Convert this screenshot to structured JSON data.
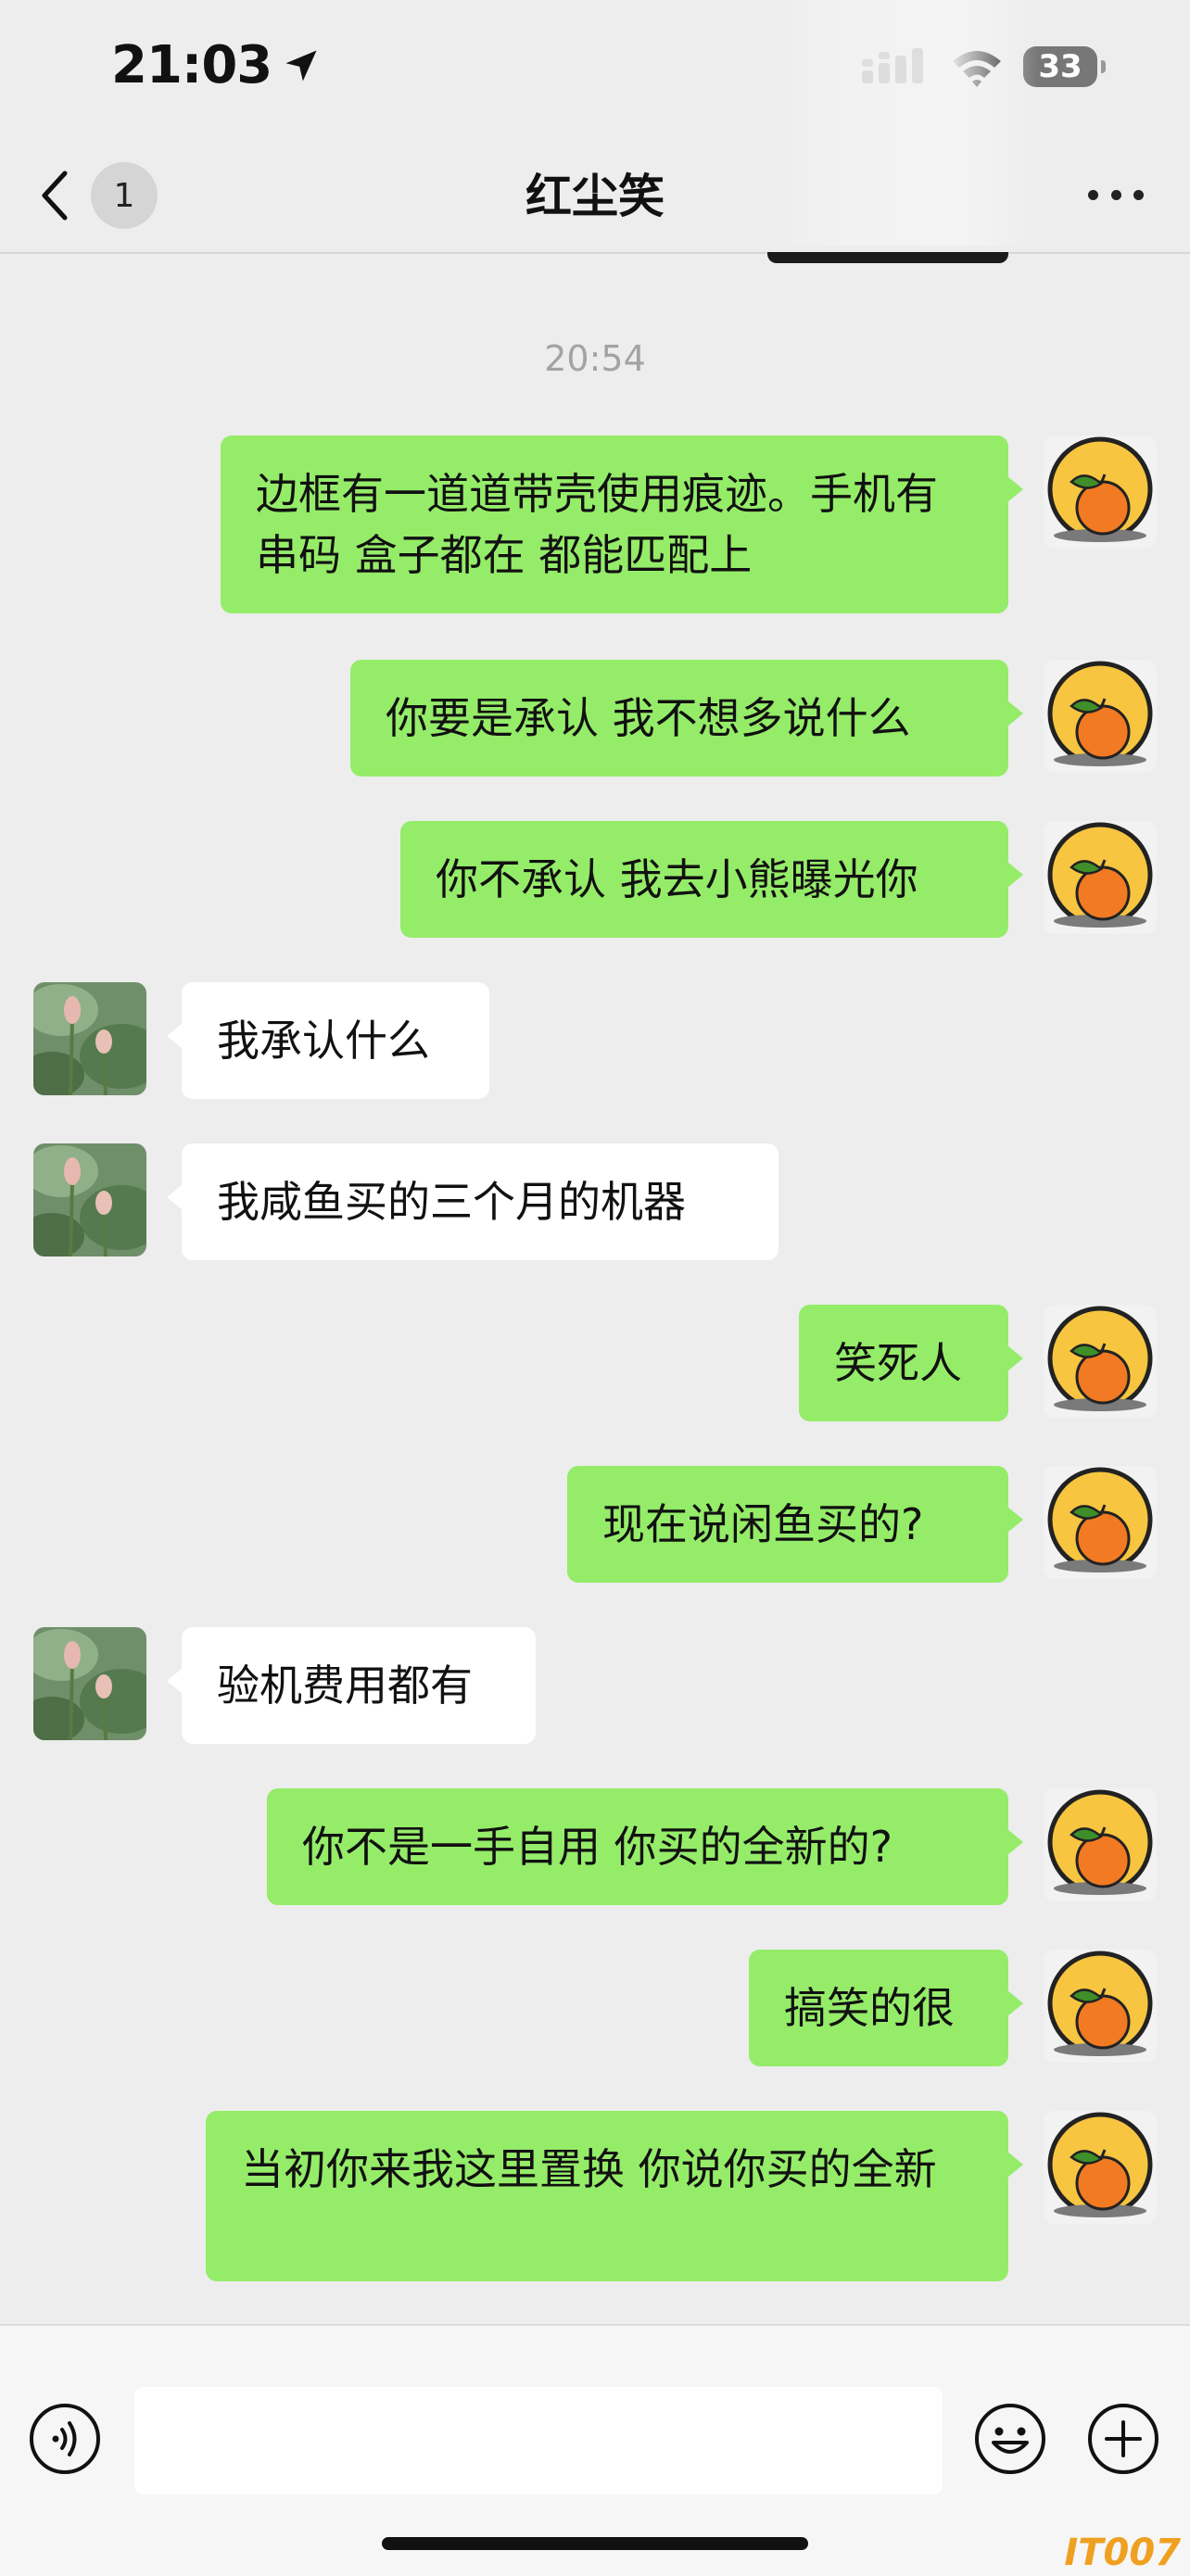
{
  "status_bar": {
    "time": "21:03",
    "battery": "33"
  },
  "nav": {
    "unread_count": "1",
    "title": "红尘笑"
  },
  "timestamp": "20:54",
  "messages": [
    {
      "side": "out",
      "text": "边框有一道道带壳使用痕迹。手机有串码  盒子都在 都能匹配上"
    },
    {
      "side": "out",
      "text": "你要是承认 我不想多说什么"
    },
    {
      "side": "out",
      "text": "你不承认 我去小熊曝光你"
    },
    {
      "side": "in",
      "text": "我承认什么"
    },
    {
      "side": "in",
      "text": "我咸鱼买的三个月的机器"
    },
    {
      "side": "out",
      "text": "笑死人"
    },
    {
      "side": "out",
      "text": "现在说闲鱼买的?"
    },
    {
      "side": "in",
      "text": "验机费用都有"
    },
    {
      "side": "out",
      "text": "你不是一手自用 你买的全新的?"
    },
    {
      "side": "out",
      "text": "搞笑的很"
    },
    {
      "side": "out",
      "text": "当初你来我这里置换 你说你买的全新"
    }
  ],
  "input": {
    "value": ""
  },
  "watermark": "IT007",
  "colors": {
    "background": "#ededed",
    "outgoing_bubble": "#95ec69",
    "incoming_bubble": "#ffffff"
  },
  "icons": {
    "back": "chevron-left-icon",
    "more": "more-dots-icon",
    "location": "location-arrow-icon",
    "signal": "signal-icon",
    "wifi": "wifi-icon",
    "voice": "voice-icon",
    "emoji": "emoji-icon",
    "plus": "plus-icon"
  }
}
